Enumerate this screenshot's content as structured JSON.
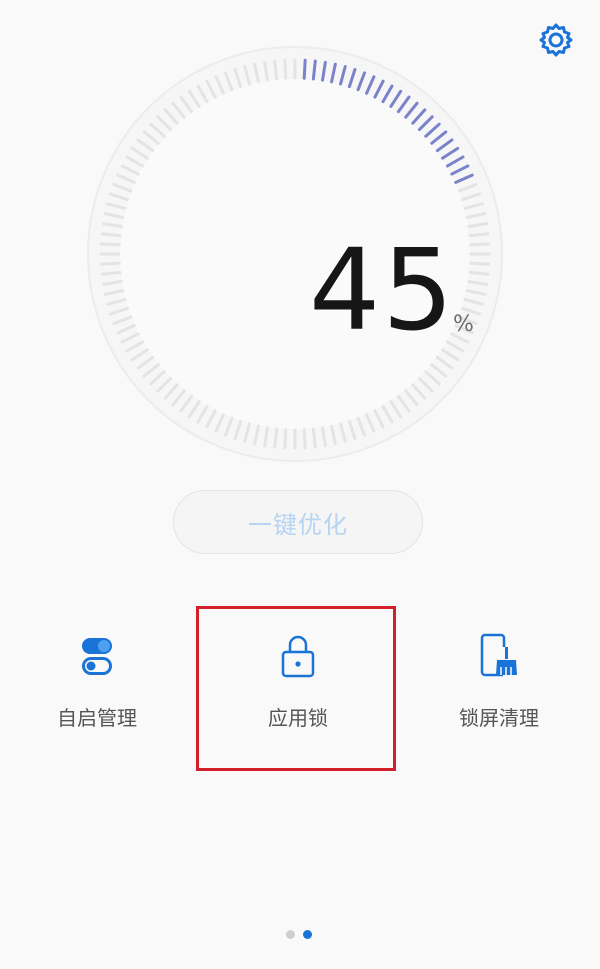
{
  "header": {
    "settings_icon": "gear-icon"
  },
  "gauge": {
    "value": "45",
    "unit": "%",
    "progress_percent": 45,
    "ring_color": "#e4e4e4",
    "progress_color": "#7a83c9"
  },
  "optimize_button": {
    "label": "一键优化"
  },
  "features": [
    {
      "id": "autostart",
      "label": "自启管理",
      "icon": "toggle-switch-icon"
    },
    {
      "id": "app-lock",
      "label": "应用锁",
      "icon": "lock-icon"
    },
    {
      "id": "lock-screen-clean",
      "label": "锁屏清理",
      "icon": "phone-broom-icon"
    }
  ],
  "pager": {
    "total": 2,
    "current": 2
  },
  "colors": {
    "accent": "#1a73d6",
    "highlight": "#d21f2a",
    "inactive_dot": "#cfcfcf"
  }
}
